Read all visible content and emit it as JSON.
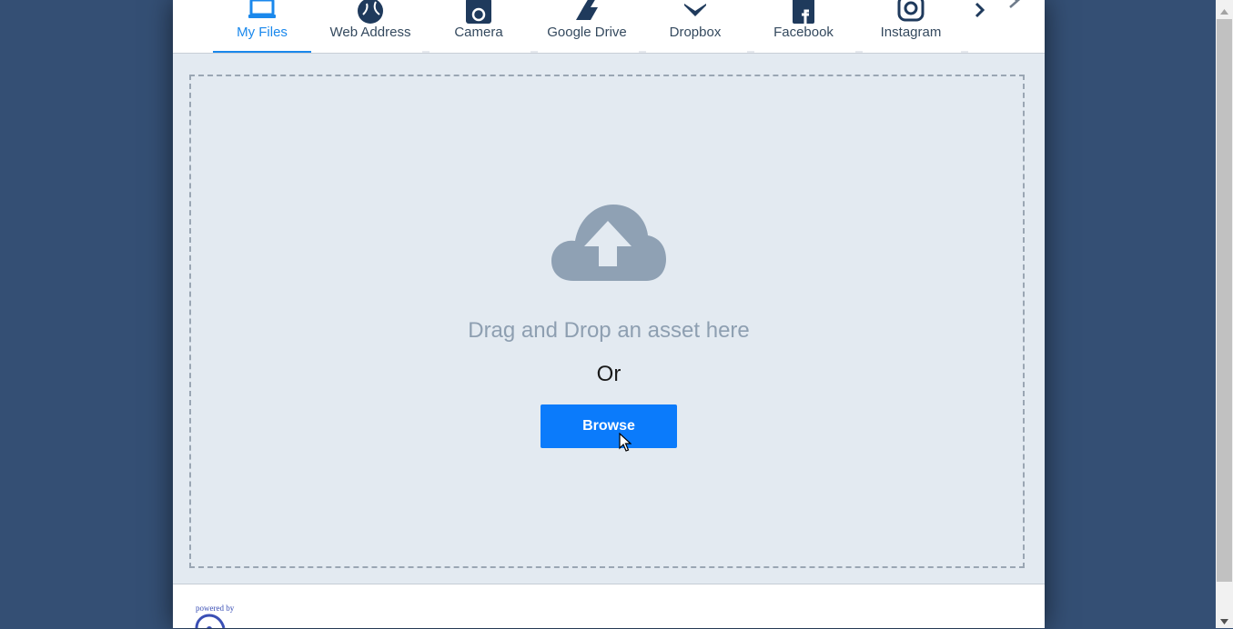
{
  "tabs": [
    {
      "label": "My Files",
      "icon": "laptop-icon",
      "active": true
    },
    {
      "label": "Web Address",
      "icon": "globe-icon",
      "active": false
    },
    {
      "label": "Camera",
      "icon": "camera-icon",
      "active": false
    },
    {
      "label": "Google Drive",
      "icon": "google-drive-icon",
      "active": false
    },
    {
      "label": "Dropbox",
      "icon": "dropbox-icon",
      "active": false
    },
    {
      "label": "Facebook",
      "icon": "facebook-icon",
      "active": false
    },
    {
      "label": "Instagram",
      "icon": "instagram-icon",
      "active": false
    }
  ],
  "dropzone": {
    "icon": "cloud-upload-icon",
    "drag_text": "Drag and Drop an asset here",
    "or_text": "Or",
    "browse_label": "Browse"
  },
  "footer": {
    "powered_by": "powered by",
    "logo_icon": "cloud-logo-icon"
  },
  "colors": {
    "backdrop": "#344f74",
    "accent": "#1a88ec",
    "button": "#0b7bfb",
    "dropzone_bg": "#e3eaf1",
    "icon_dark": "#1f3a5c",
    "muted_text": "#8e9fb1"
  }
}
